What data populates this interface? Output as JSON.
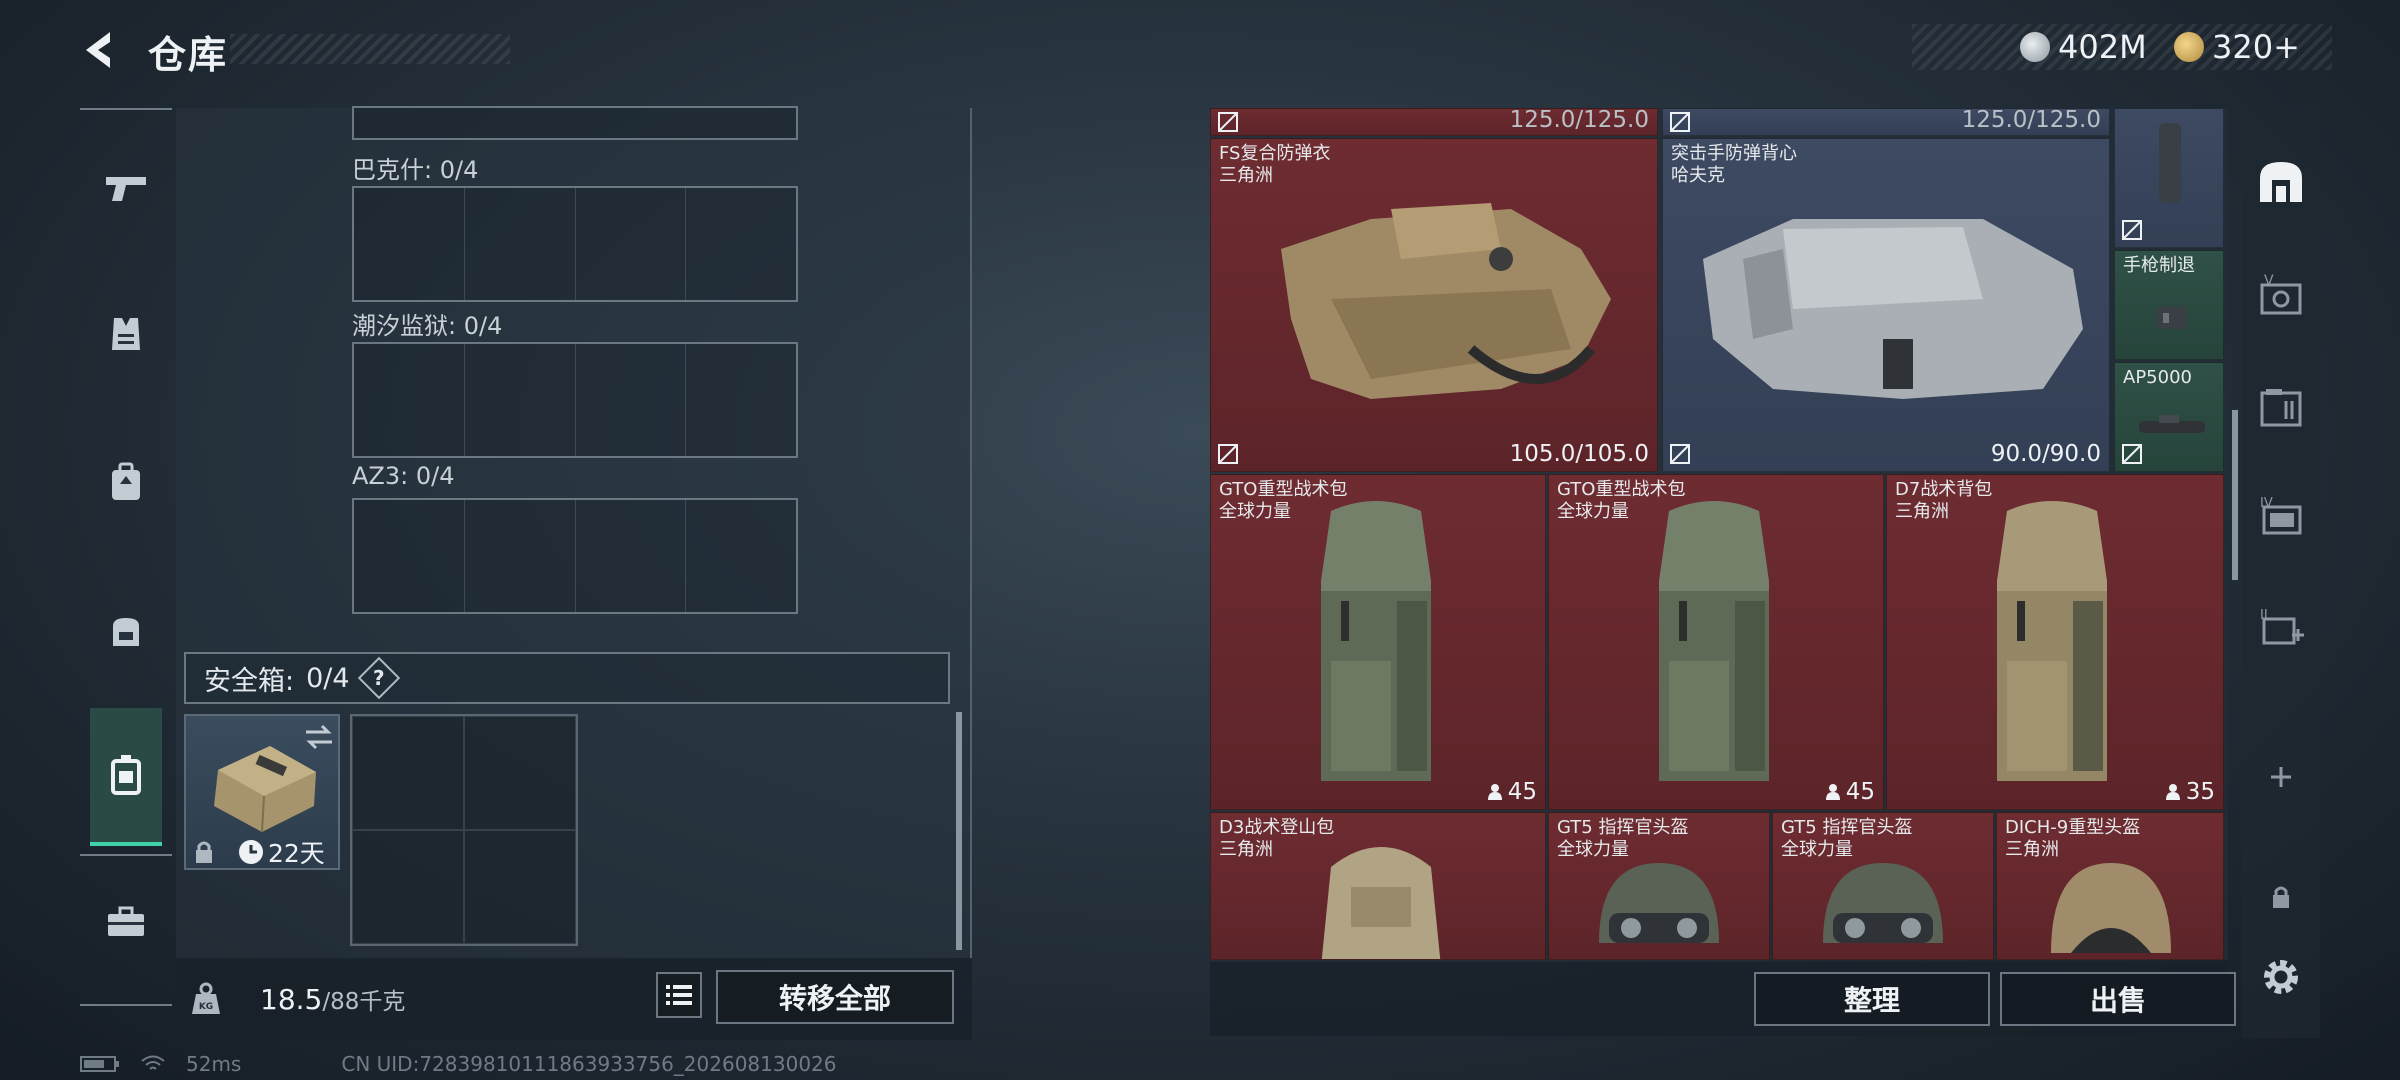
{
  "header": {
    "title": "仓库",
    "currencies": [
      {
        "icon": "silver-coin-icon",
        "value": "402M"
      },
      {
        "icon": "gold-coin-icon",
        "value": "320+"
      }
    ]
  },
  "left_nav": [
    "pistol-icon",
    "vest-icon",
    "backpack-icon",
    "small-backpack-icon",
    "safe-case-icon",
    "toolbox-icon"
  ],
  "stash_groups": [
    {
      "label": "巴克什: 0/4"
    },
    {
      "label": "潮汐监狱: 0/4"
    },
    {
      "label": "AZ3: 0/4"
    }
  ],
  "safe_box": {
    "label": "安全箱:",
    "count": "0/4",
    "help": "?",
    "item_days": "22天"
  },
  "weight": {
    "current": "18.5",
    "max": "/88千克"
  },
  "buttons": {
    "transfer_all": "转移全部",
    "organize": "整理",
    "sell": "出售"
  },
  "status": {
    "ping": "52ms",
    "uid": "CN UID:7283981011186393375​6_202608130026"
  },
  "items": {
    "top_left_value": "125.0/125.0",
    "top_right_value": "125.0/125.0",
    "vest1": {
      "name": "FS复合防弹衣",
      "origin": "三角洲",
      "value": "105.0/105.0"
    },
    "vest2": {
      "name": "突击手防弹背心",
      "origin": "哈夫克",
      "value": "90.0/90.0"
    },
    "small1": {
      "name": "手枪制退"
    },
    "small2": {
      "name": "AP5000"
    },
    "bag1": {
      "name": "GTO重型战术包",
      "origin": "全球力量",
      "count": "45"
    },
    "bag2": {
      "name": "GTO重型战术包",
      "origin": "全球力量",
      "count": "45"
    },
    "bag3": {
      "name": "D7战术背包",
      "origin": "三角洲",
      "count": "35"
    },
    "bag4": {
      "name": "D3战术登山包",
      "origin": "三角洲"
    },
    "helmet1": {
      "name": "GT5 指挥官头盔",
      "origin": "全球力量"
    },
    "helmet2": {
      "name": "GT5 指挥官头盔",
      "origin": "全球力量"
    },
    "helmet3": {
      "name": "DICH-9重型头盔",
      "origin": "三角洲"
    }
  },
  "colors": {
    "accent": "#3fd2aa",
    "rarity_red": "#6e2c31",
    "rarity_blue": "#3d4a62",
    "rarity_green": "#2f5147"
  }
}
